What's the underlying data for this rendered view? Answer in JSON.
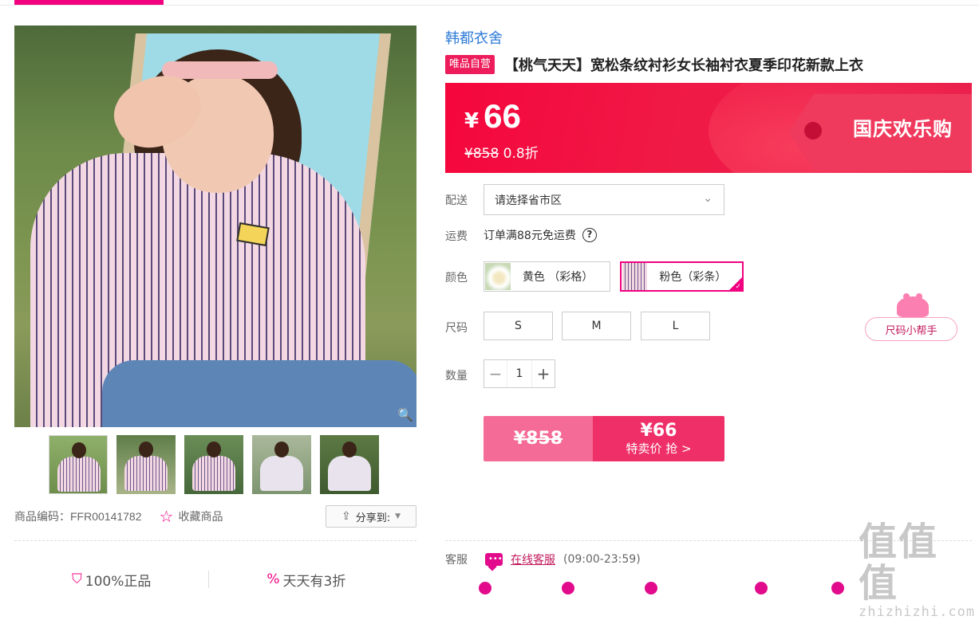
{
  "brand": "韩都衣舍",
  "badge": "唯品自营",
  "title": "【桃气天天】宽松条纹衬衫女长袖衬衣夏季印花新款上衣",
  "price": {
    "currency": "¥",
    "current": "66",
    "original": "¥858",
    "discount": "0.8折",
    "event": "国庆欢乐购"
  },
  "delivery": {
    "label": "配送",
    "placeholder": "请选择省市区"
  },
  "shipping": {
    "label": "运费",
    "text": "订单满88元免运费",
    "help": "?"
  },
  "color": {
    "label": "颜色",
    "options": [
      {
        "name": "黄色 （彩格）",
        "selected": false
      },
      {
        "name": "粉色（彩条）",
        "selected": true
      }
    ]
  },
  "size": {
    "label": "尺码",
    "options": [
      "S",
      "M",
      "L"
    ],
    "helper": "尺码小帮手"
  },
  "quantity": {
    "label": "数量",
    "value": "1",
    "minus": "−",
    "plus": "+"
  },
  "buy": {
    "original": "¥858",
    "price": "¥66",
    "label": "特卖价 抢 >"
  },
  "gallery": {
    "product_code_label": "商品编码：",
    "product_code": "FFR00141782",
    "favorite": "收藏商品",
    "share": "分享到:"
  },
  "promises": [
    "100%正品",
    "天天有3折"
  ],
  "service": {
    "label": "客服",
    "link": "在线客服",
    "hours": "(09:00-23:59)"
  },
  "watermark": {
    "glyphs": "值值值",
    "site": "zhizhizhi.com"
  },
  "colors": {
    "accent": "#f10180",
    "banner": "#f01a46",
    "buy": "#ef2f68",
    "brand_link": "#2f7bd6"
  }
}
